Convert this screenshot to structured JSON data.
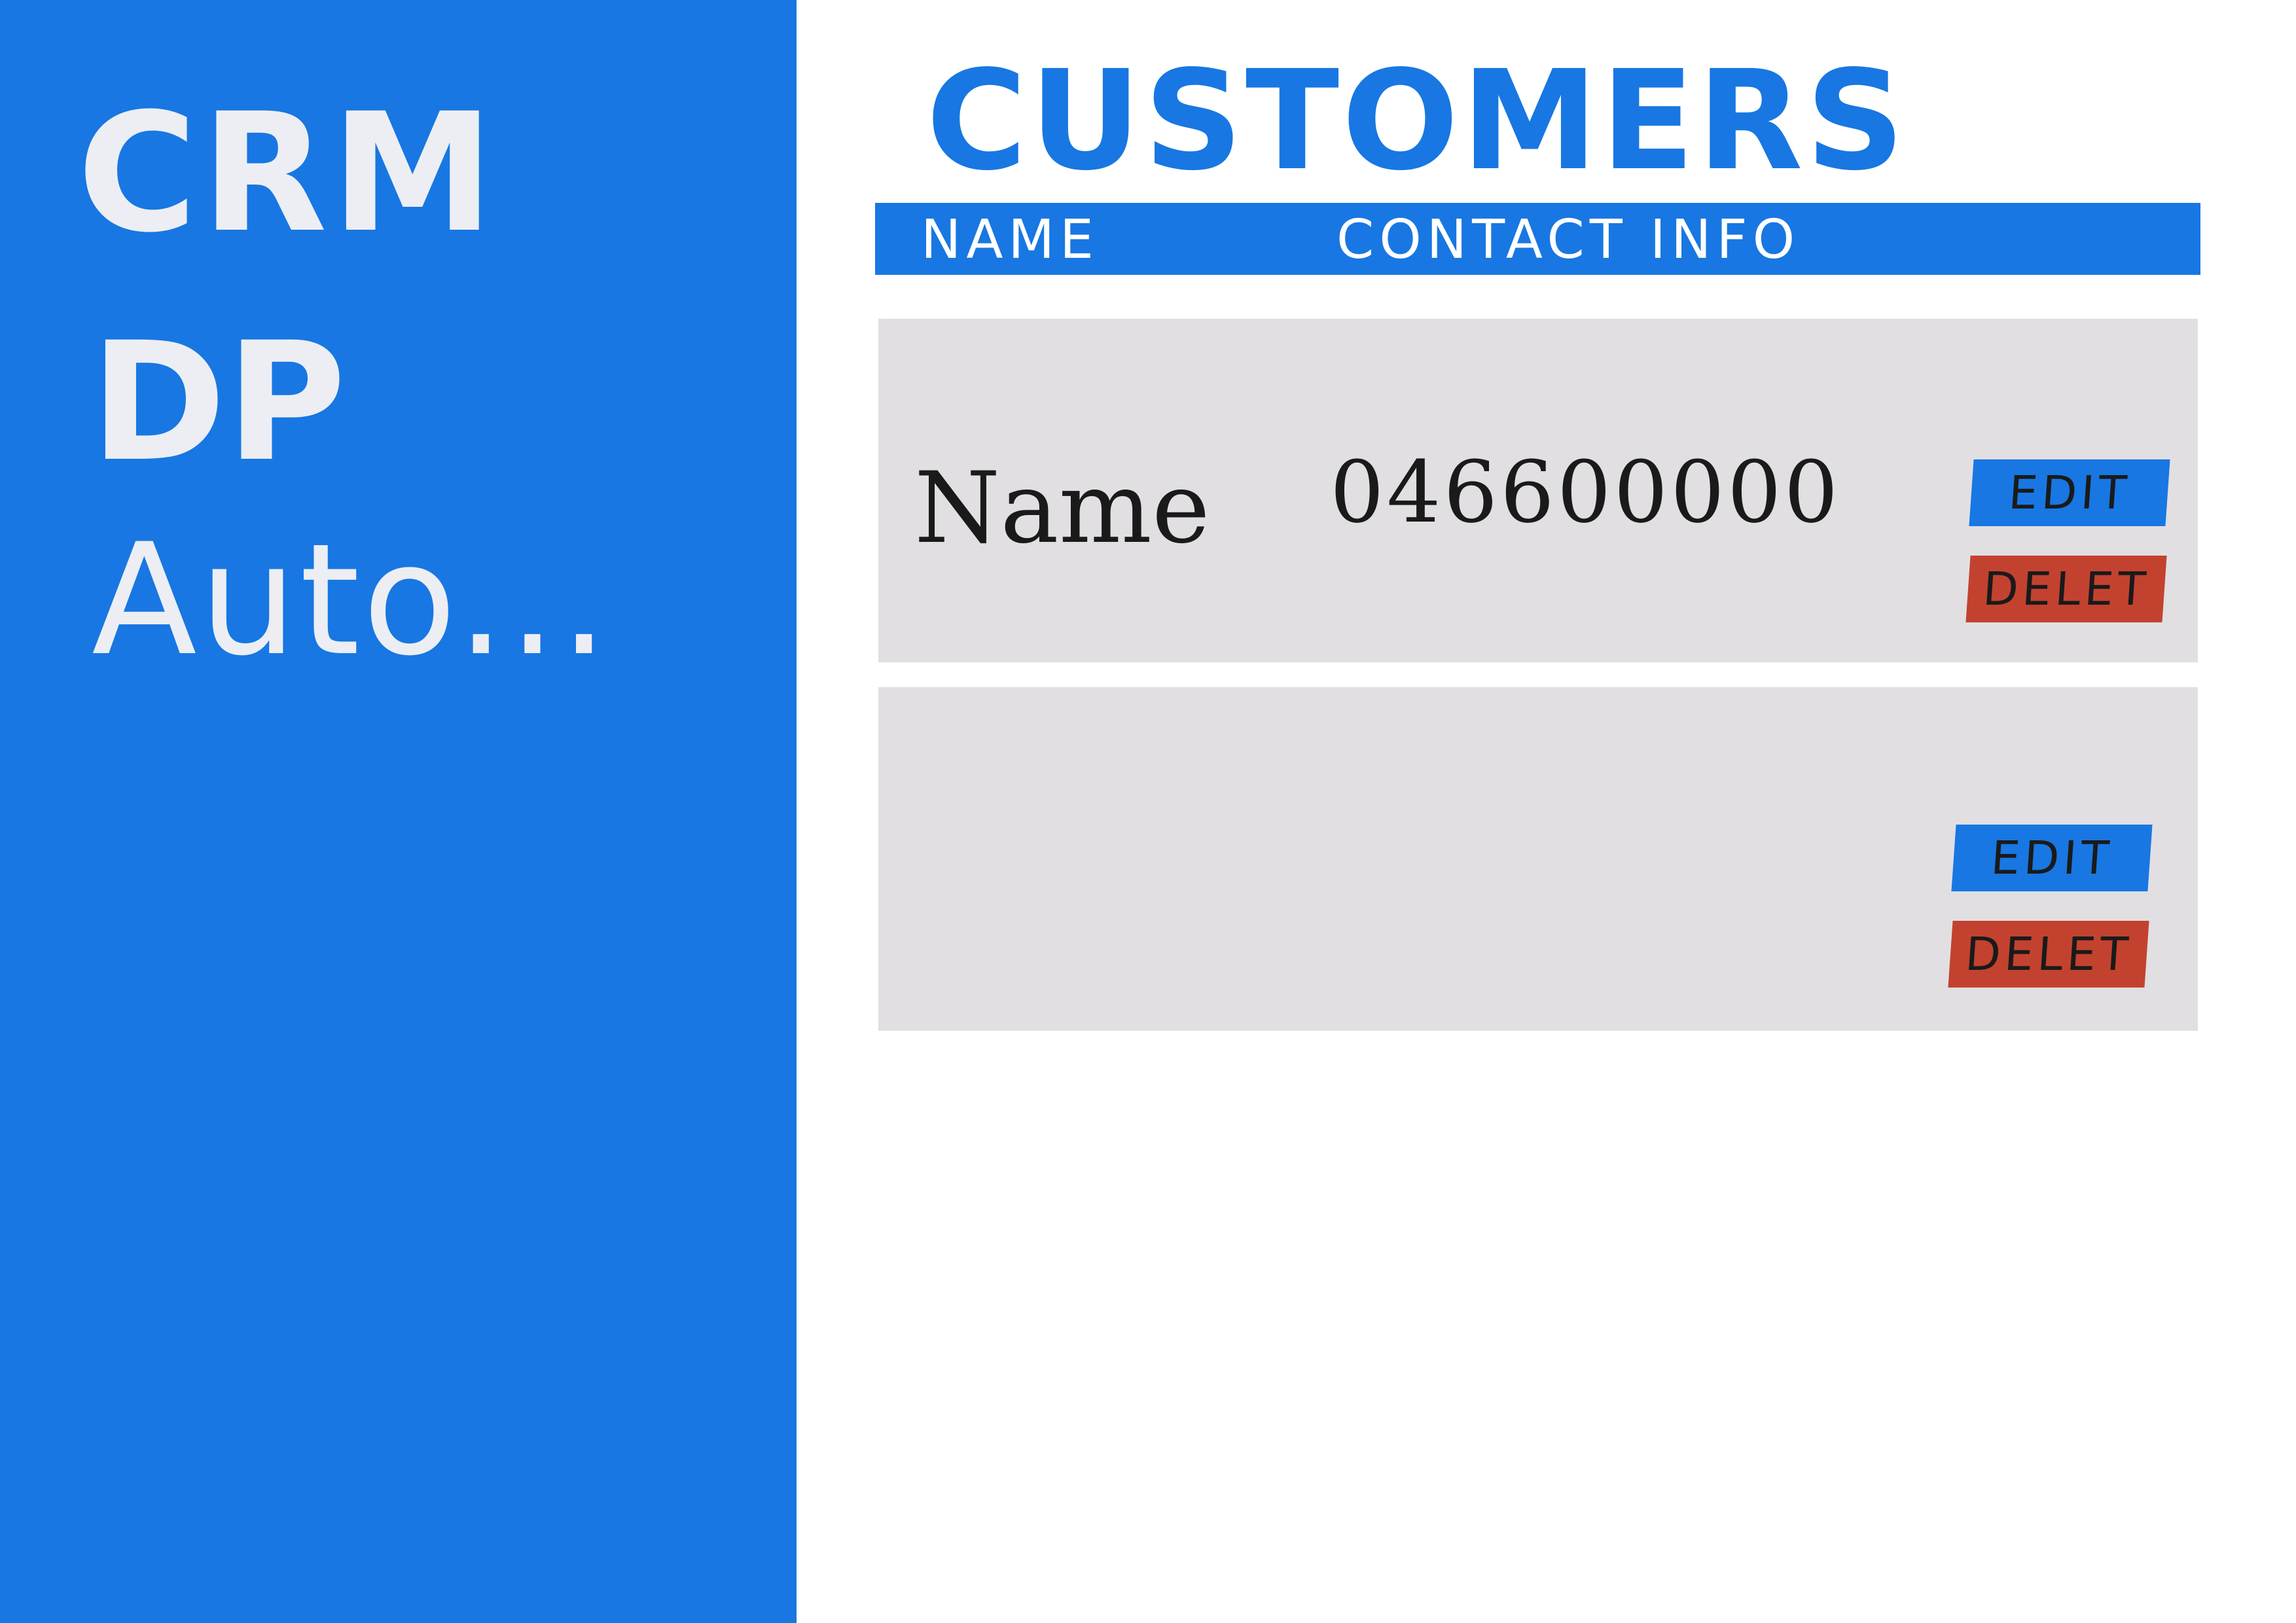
{
  "sidebar": {
    "items": [
      {
        "label": "CRM"
      },
      {
        "label": "DP"
      },
      {
        "label": "Auto..."
      }
    ]
  },
  "main": {
    "title": "CUSTOMERS",
    "table": {
      "columns": [
        "NAME",
        "CONTACT INFO"
      ],
      "rows": [
        {
          "name": "Name",
          "contact": "046600000",
          "edit_label": "EDIT",
          "delete_label": "DELET"
        },
        {
          "name": "",
          "contact": "",
          "edit_label": "EDIT",
          "delete_label": "DELET"
        }
      ]
    }
  },
  "colors": {
    "primary_blue": "#1877e2",
    "row_background": "#e1dfe2",
    "delete_red": "#c2422f",
    "sidebar_text": "#eceef3"
  }
}
